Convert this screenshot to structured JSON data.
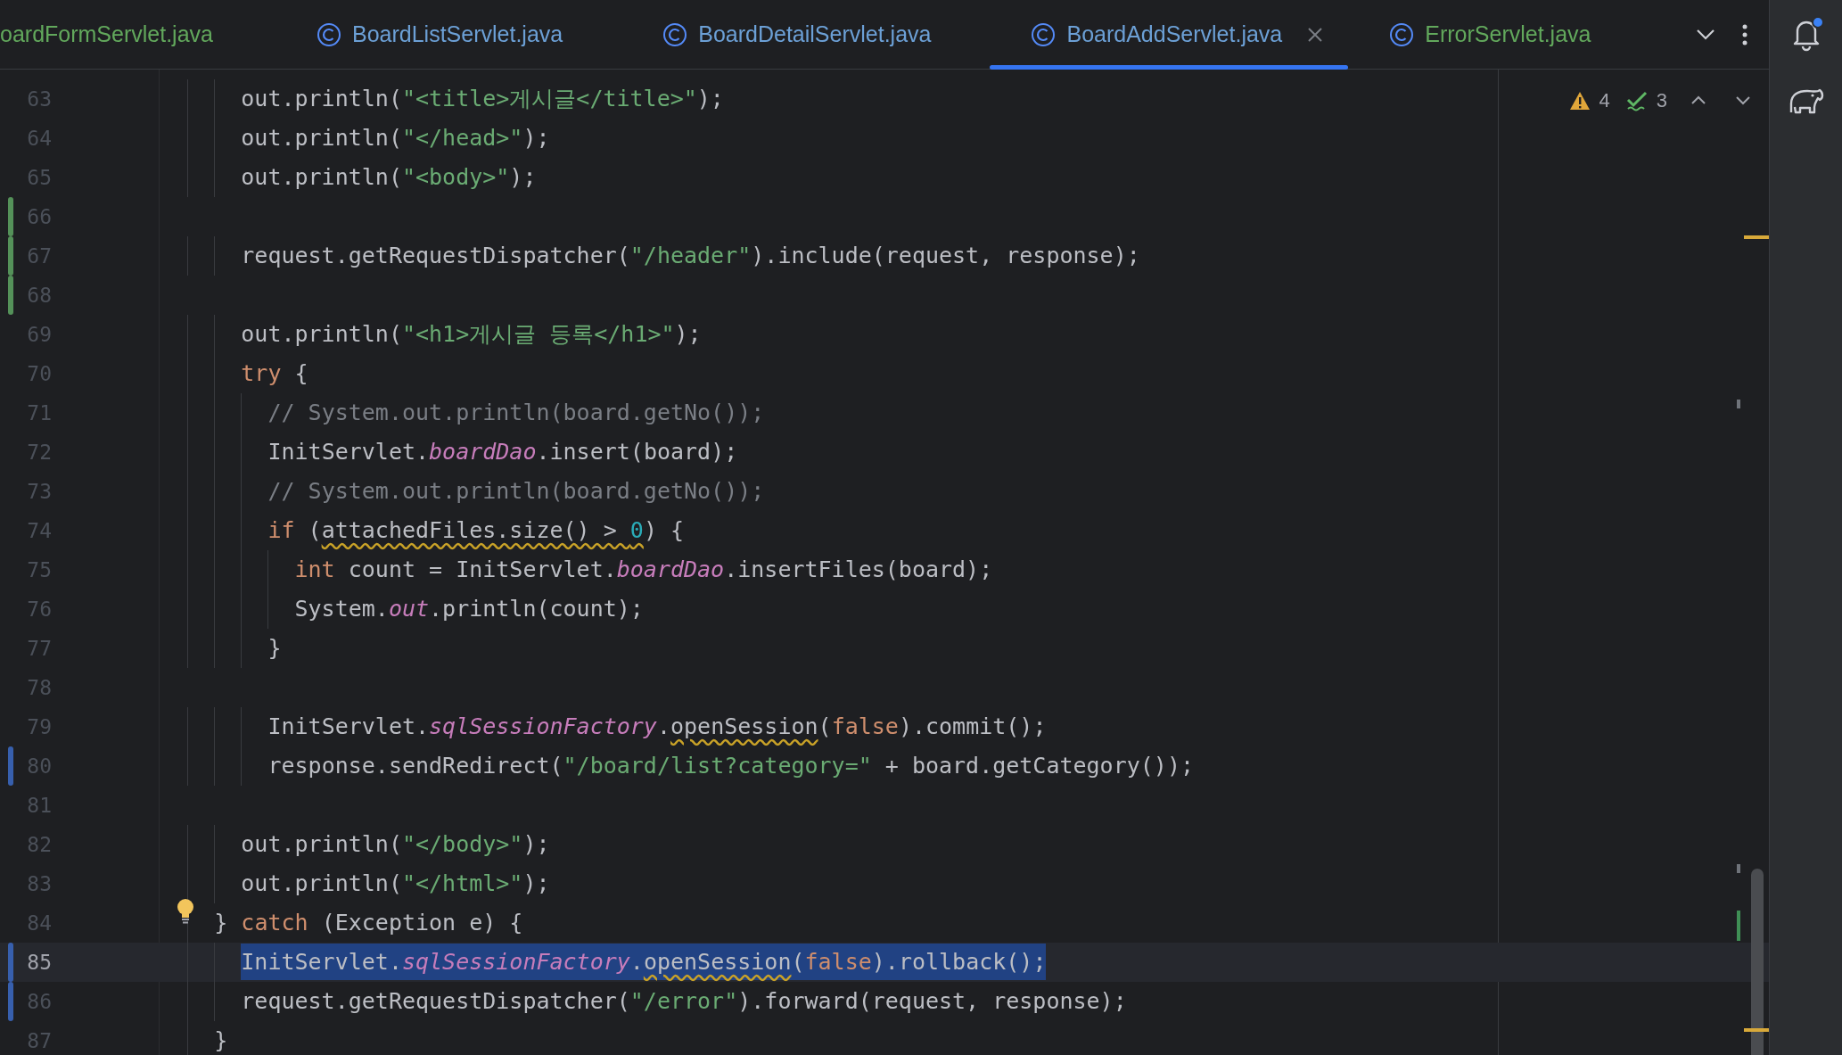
{
  "tabs": [
    {
      "label": "oardFormServlet.java",
      "has_icon": false,
      "kind": "added",
      "selected": false
    },
    {
      "label": "BoardListServlet.java",
      "has_icon": true,
      "kind": "modified",
      "selected": false
    },
    {
      "label": "BoardDetailServlet.java",
      "has_icon": true,
      "kind": "modified",
      "selected": false
    },
    {
      "label": "BoardAddServlet.java",
      "has_icon": true,
      "kind": "modified",
      "selected": true
    },
    {
      "label": "ErrorServlet.java",
      "has_icon": true,
      "kind": "added",
      "selected": false
    }
  ],
  "inspections": {
    "warnings": "4",
    "weak_warnings": "3"
  },
  "notifications_unread": true,
  "lines": [
    {
      "number": "63",
      "current": false,
      "selected": false,
      "tokens": [
        {
          "text": "      out.println(",
          "kind": "plain"
        },
        {
          "text": "\"<title>게시글</title>\"",
          "kind": "string"
        },
        {
          "text": ");",
          "kind": "plain"
        }
      ]
    },
    {
      "number": "64",
      "current": false,
      "selected": false,
      "tokens": [
        {
          "text": "      out.println(",
          "kind": "plain"
        },
        {
          "text": "\"</head>\"",
          "kind": "string"
        },
        {
          "text": ");",
          "kind": "plain"
        }
      ]
    },
    {
      "number": "65",
      "current": false,
      "selected": false,
      "tokens": [
        {
          "text": "      out.println(",
          "kind": "plain"
        },
        {
          "text": "\"<body>\"",
          "kind": "string"
        },
        {
          "text": ");",
          "kind": "plain"
        }
      ]
    },
    {
      "number": "66",
      "current": false,
      "selected": false,
      "kind": "added"
    },
    {
      "number": "67",
      "current": false,
      "selected": false,
      "kind": "added",
      "tokens": [
        {
          "text": "      request.getRequestDispatcher(",
          "kind": "plain"
        },
        {
          "text": "\"/header\"",
          "kind": "string"
        },
        {
          "text": ").include(request, response);",
          "kind": "plain"
        }
      ]
    },
    {
      "number": "68",
      "current": false,
      "selected": false,
      "kind": "added"
    },
    {
      "number": "69",
      "current": false,
      "selected": false,
      "tokens": [
        {
          "text": "      out.println(",
          "kind": "plain"
        },
        {
          "text": "\"<h1>게시글 등록</h1>\"",
          "kind": "string"
        },
        {
          "text": ");",
          "kind": "plain"
        }
      ]
    },
    {
      "number": "70",
      "current": false,
      "selected": false,
      "tokens": [
        {
          "text": "      try",
          "kind": "keyword"
        },
        {
          "text": " {",
          "kind": "plain"
        }
      ]
    },
    {
      "number": "71",
      "current": false,
      "selected": false,
      "tokens": [
        {
          "text": "        // System.out.println(board.getNo());",
          "kind": "comment"
        }
      ]
    },
    {
      "number": "72",
      "current": false,
      "selected": false,
      "tokens": [
        {
          "text": "        InitServlet.",
          "kind": "plain"
        },
        {
          "text": "boardDao",
          "kind": "field"
        },
        {
          "text": ".insert(board);",
          "kind": "plain"
        }
      ]
    },
    {
      "number": "73",
      "current": false,
      "selected": false,
      "tokens": [
        {
          "text": "        // System.out.println(board.getNo());",
          "kind": "comment"
        }
      ]
    },
    {
      "number": "74",
      "current": false,
      "selected": false,
      "tokens": [
        {
          "text": "        if",
          "kind": "keyword"
        },
        {
          "text": " (",
          "kind": "plain"
        },
        {
          "text": "attachedFiles.size() > ",
          "kind": "warn"
        },
        {
          "text": "0",
          "kind": "warn_number"
        },
        {
          "text": ") {",
          "kind": "plain"
        }
      ]
    },
    {
      "number": "75",
      "current": false,
      "selected": false,
      "tokens": [
        {
          "text": "          int",
          "kind": "keyword"
        },
        {
          "text": " count = InitServlet.",
          "kind": "plain"
        },
        {
          "text": "boardDao",
          "kind": "field"
        },
        {
          "text": ".insertFiles(board);",
          "kind": "plain"
        }
      ]
    },
    {
      "number": "76",
      "current": false,
      "selected": false,
      "tokens": [
        {
          "text": "          System.",
          "kind": "plain"
        },
        {
          "text": "out",
          "kind": "field"
        },
        {
          "text": ".println(count);",
          "kind": "plain"
        }
      ]
    },
    {
      "number": "77",
      "current": false,
      "selected": false,
      "tokens": [
        {
          "text": "        }",
          "kind": "plain"
        }
      ]
    },
    {
      "number": "78",
      "current": false,
      "selected": false
    },
    {
      "number": "79",
      "current": false,
      "selected": false,
      "tokens": [
        {
          "text": "        InitServlet.",
          "kind": "plain"
        },
        {
          "text": "sqlSessionFactory",
          "kind": "field"
        },
        {
          "text": ".",
          "kind": "plain"
        },
        {
          "text": "openSession",
          "kind": "warn"
        },
        {
          "text": "(",
          "kind": "plain"
        },
        {
          "text": "false",
          "kind": "keyword"
        },
        {
          "text": ").commit();",
          "kind": "plain"
        }
      ]
    },
    {
      "number": "80",
      "current": false,
      "selected": false,
      "kind": "modified",
      "tokens": [
        {
          "text": "        response.sendRedirect(",
          "kind": "plain"
        },
        {
          "text": "\"/board/list?category=\"",
          "kind": "string"
        },
        {
          "text": " + board.getCategory());",
          "kind": "plain"
        }
      ]
    },
    {
      "number": "81",
      "current": false,
      "selected": false
    },
    {
      "number": "82",
      "current": false,
      "selected": false,
      "tokens": [
        {
          "text": "      out.println(",
          "kind": "plain"
        },
        {
          "text": "\"</body>\"",
          "kind": "string"
        },
        {
          "text": ");",
          "kind": "plain"
        }
      ]
    },
    {
      "number": "83",
      "current": false,
      "selected": false,
      "tokens": [
        {
          "text": "      out.println(",
          "kind": "plain"
        },
        {
          "text": "\"</html>\"",
          "kind": "string"
        },
        {
          "text": ");",
          "kind": "plain"
        }
      ]
    },
    {
      "number": "84",
      "current": false,
      "selected": false,
      "kind": "bulb",
      "tokens": [
        {
          "text": "    }",
          "kind": "plain"
        },
        {
          "text": " catch",
          "kind": "keyword"
        },
        {
          "text": " (Exception e) {",
          "kind": "plain"
        }
      ]
    },
    {
      "number": "85",
      "current": true,
      "selected": true,
      "kind": "modified",
      "tokens": [
        {
          "text": "      InitServlet.",
          "kind": "plain"
        },
        {
          "text": "sqlSessionFactory",
          "kind": "field"
        },
        {
          "text": ".",
          "kind": "plain"
        },
        {
          "text": "openSession",
          "kind": "warn"
        },
        {
          "text": "(",
          "kind": "plain"
        },
        {
          "text": "false",
          "kind": "keyword"
        },
        {
          "text": ").rollback();",
          "kind": "plain"
        }
      ]
    },
    {
      "number": "86",
      "current": false,
      "selected": false,
      "kind": "modified",
      "tokens": [
        {
          "text": "      request.getRequestDispatcher(",
          "kind": "plain"
        },
        {
          "text": "\"/error\"",
          "kind": "string"
        },
        {
          "text": ").forward(request, response);",
          "kind": "plain"
        }
      ]
    },
    {
      "number": "87",
      "current": false,
      "selected": false,
      "tokens": [
        {
          "text": "    }",
          "kind": "plain"
        }
      ]
    }
  ]
}
